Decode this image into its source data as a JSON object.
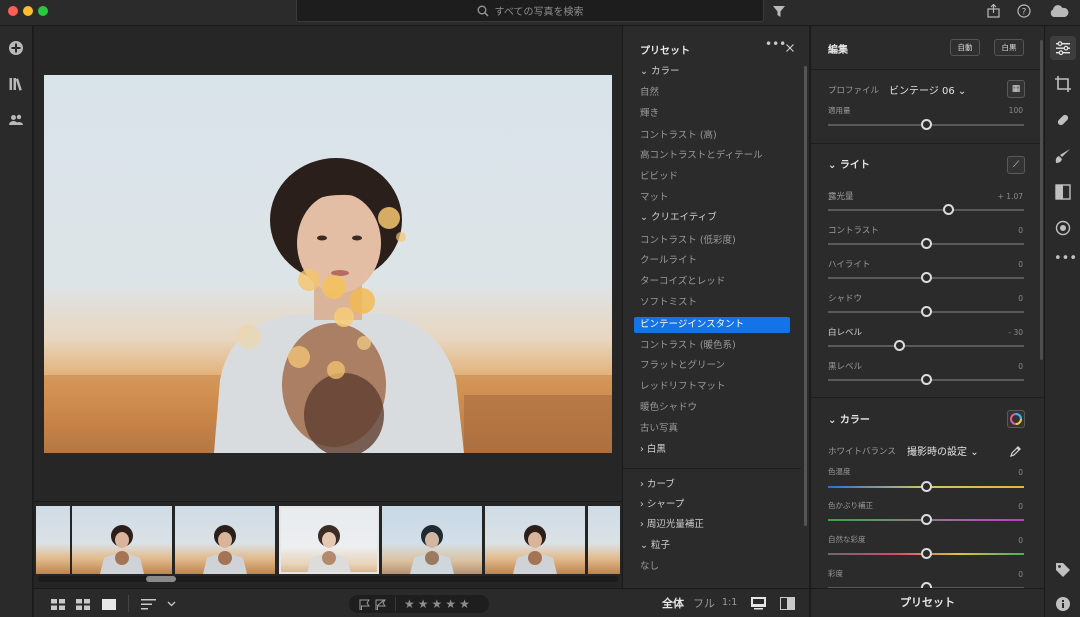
{
  "titlebar": {
    "search_placeholder": "すべての写真を検索",
    "traffic_colors": [
      "#ff5f57",
      "#febc2e",
      "#28c840"
    ]
  },
  "presets": {
    "title": "プリセット",
    "groups_top": [
      {
        "label": "カラー",
        "expanded": true,
        "items": [
          "自然",
          "輝き",
          "コントラスト (高)",
          "高コントラストとディテール",
          "ビビッド",
          "マット"
        ]
      },
      {
        "label": "クリエイティブ",
        "expanded": true,
        "items": [
          "コントラスト (低彩度)",
          "クールライト",
          "ターコイズとレッド",
          "ソフトミスト",
          "ビンテージインスタント",
          "コントラスト (暖色系)",
          "フラットとグリーン",
          "レッドリフトマット",
          "暖色シャドウ",
          "古い写真"
        ]
      },
      {
        "label": "白黒",
        "expanded": false
      }
    ],
    "selected_item": "ビンテージインスタント",
    "groups_bottom": [
      {
        "label": "カーブ",
        "expanded": false
      },
      {
        "label": "シャープ",
        "expanded": false
      },
      {
        "label": "周辺光量補正",
        "expanded": false
      },
      {
        "label": "粒子",
        "expanded": true,
        "items": [
          "なし"
        ]
      }
    ]
  },
  "edit": {
    "title": "編集",
    "auto_button": "自動",
    "bw_button": "白黒",
    "profile_label": "プロファイル",
    "profile_value": "ビンテージ 06",
    "amount_label": "適用量",
    "amount_value": "100",
    "amount_level": 0.5,
    "light": {
      "title": "ライト",
      "sliders": [
        {
          "label": "露光量",
          "value": "+ 1.07",
          "level": 0.61
        },
        {
          "label": "コントラスト",
          "value": "0",
          "level": 0.5
        },
        {
          "label": "ハイライト",
          "value": "0",
          "level": 0.5
        },
        {
          "label": "シャドウ",
          "value": "0",
          "level": 0.5
        },
        {
          "label": "白レベル",
          "value": "- 30",
          "level": 0.36
        },
        {
          "label": "黒レベル",
          "value": "0",
          "level": 0.5
        }
      ]
    },
    "color": {
      "title": "カラー",
      "wb_label": "ホワイトバランス",
      "wb_value": "撮影時の設定",
      "sliders": [
        {
          "label": "色温度",
          "value": "0",
          "level": 0.5
        },
        {
          "label": "色かぶり補正",
          "value": "0",
          "level": 0.5
        },
        {
          "label": "自然な彩度",
          "value": "0",
          "level": 0.5
        },
        {
          "label": "彩度",
          "value": "0",
          "level": 0.5
        }
      ]
    }
  },
  "bottombar": {
    "view_all": "全体",
    "view_full": "フル",
    "view_ratio": "1:1",
    "stars": [
      "★",
      "★",
      "★",
      "★",
      "★"
    ]
  },
  "presets_button": "プリセット"
}
